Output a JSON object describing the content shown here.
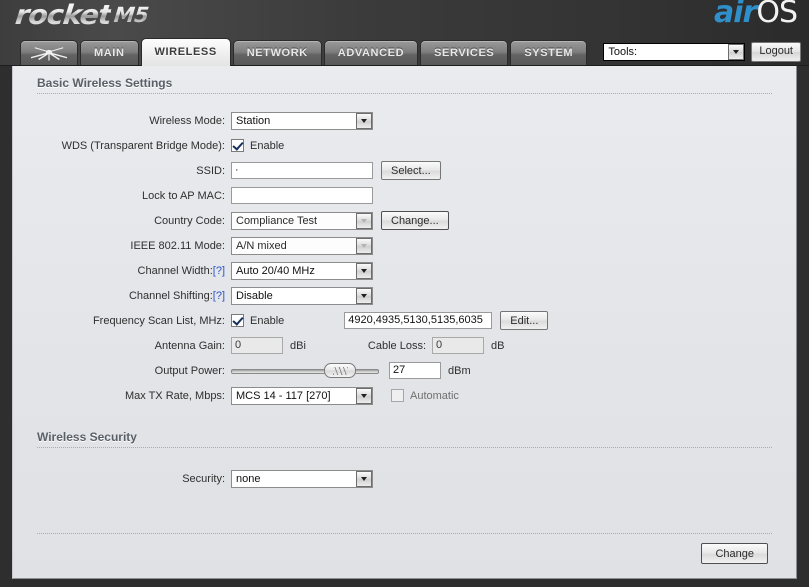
{
  "header": {
    "brand_word": "rocket",
    "brand_model": "M5",
    "logo_air": "air",
    "logo_os": "OS",
    "tools_label": "Tools:",
    "logout_label": "Logout",
    "tabs": [
      {
        "label": "",
        "name": "tab-ubiquiti-logo",
        "active": false
      },
      {
        "label": "MAIN",
        "name": "tab-main",
        "active": false
      },
      {
        "label": "WIRELESS",
        "name": "tab-wireless",
        "active": true
      },
      {
        "label": "NETWORK",
        "name": "tab-network",
        "active": false
      },
      {
        "label": "ADVANCED",
        "name": "tab-advanced",
        "active": false
      },
      {
        "label": "SERVICES",
        "name": "tab-services",
        "active": false
      },
      {
        "label": "SYSTEM",
        "name": "tab-system",
        "active": false
      }
    ]
  },
  "basic": {
    "section_title": "Basic Wireless Settings",
    "wireless_mode_label": "Wireless Mode:",
    "wireless_mode_value": "Station",
    "wds_label": "WDS (Transparent Bridge Mode):",
    "wds_checkbox_label": "Enable",
    "wds_checked": true,
    "ssid_label": "SSID:",
    "ssid_value": "·",
    "ssid_select_button": "Select...",
    "lock_ap_mac_label": "Lock to AP MAC:",
    "lock_ap_mac_value": "",
    "country_code_label": "Country Code:",
    "country_code_value": "Compliance Test",
    "country_change_button": "Change...",
    "ieee_mode_label": "IEEE 802.11 Mode:",
    "ieee_mode_value": "A/N mixed",
    "channel_width_label": "Channel Width:",
    "channel_width_help": "[?]",
    "channel_width_value": "Auto 20/40 MHz",
    "channel_shifting_label": "Channel Shifting:",
    "channel_shifting_help": "[?]",
    "channel_shifting_value": "Disable",
    "freq_scan_label": "Frequency Scan List, MHz:",
    "freq_scan_checkbox_label": "Enable",
    "freq_scan_checked": true,
    "freq_scan_value": "4920,4935,5130,5135,6035",
    "freq_scan_edit_button": "Edit...",
    "antenna_gain_label": "Antenna Gain:",
    "antenna_gain_value": "0",
    "antenna_gain_unit": "dBi",
    "cable_loss_label": "Cable Loss:",
    "cable_loss_value": "0",
    "cable_loss_unit": "dB",
    "output_power_label": "Output Power:",
    "output_power_value": "27",
    "output_power_unit": "dBm",
    "output_power_percent": 80,
    "max_tx_rate_label": "Max TX Rate, Mbps:",
    "max_tx_rate_value": "MCS 14 - 117 [270]",
    "automatic_label": "Automatic",
    "automatic_checked": false
  },
  "security": {
    "section_title": "Wireless Security",
    "security_label": "Security:",
    "security_value": "none"
  },
  "footer": {
    "change_button": "Change"
  },
  "colors": {
    "accent_blue": "#2e8fcb",
    "panel_bg": "#e4e6e9",
    "header_bg": "#3b3b3b",
    "link_blue": "#2b56c4"
  }
}
